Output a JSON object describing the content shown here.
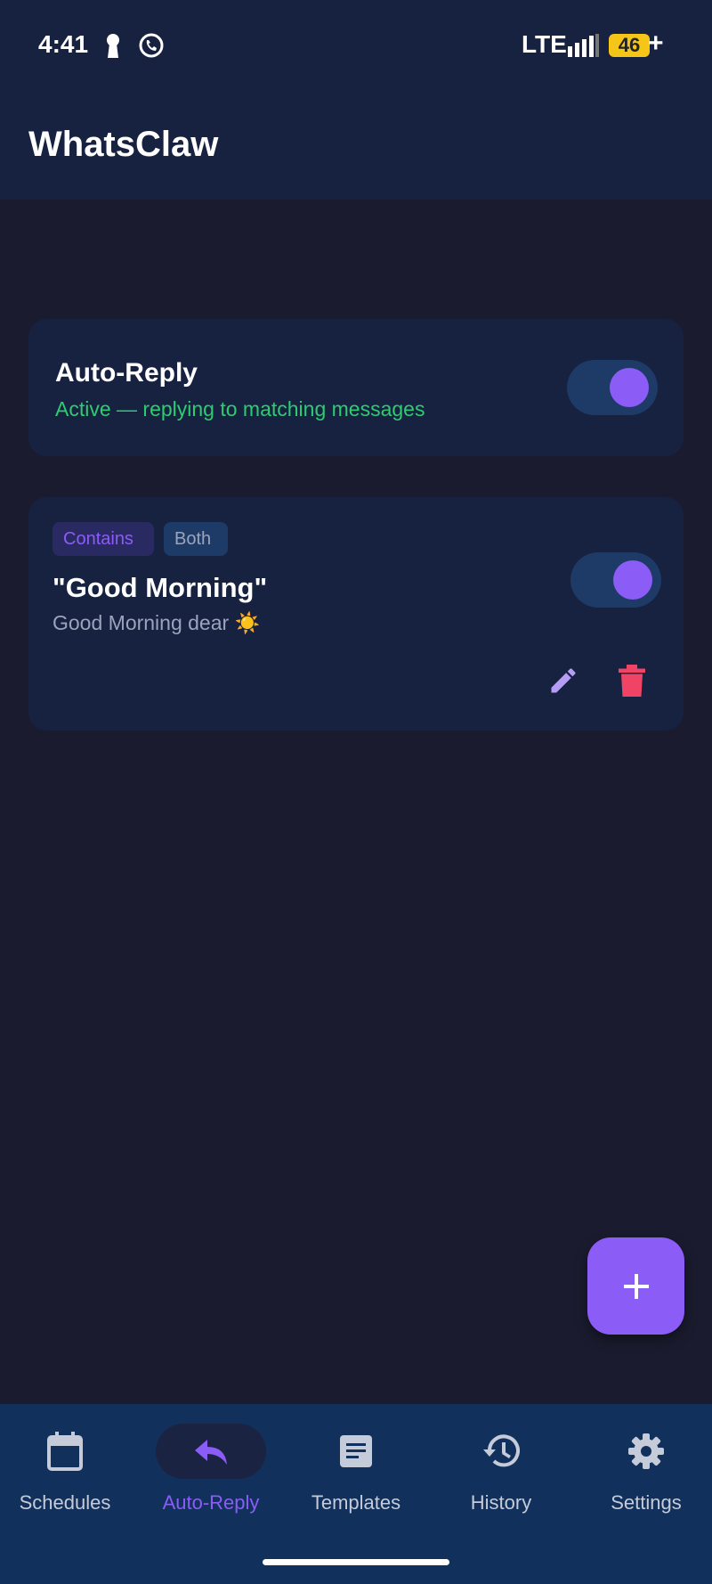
{
  "status_bar": {
    "time": "4:41",
    "network": "LTE",
    "battery": "46",
    "battery_plus": "+"
  },
  "app_bar": {
    "title": "WhatsClaw"
  },
  "auto_reply_card": {
    "title": "Auto-Reply",
    "status": "Active — replying to matching messages",
    "enabled": true,
    "status_color": "#2ecc71"
  },
  "rules": [
    {
      "match_type": "Contains",
      "scope": "Both",
      "keyword": "\"Good Morning\"",
      "reply": "Good Morning dear ☀️",
      "enabled": true
    }
  ],
  "fab": {
    "icon": "plus-icon"
  },
  "bottom_nav": {
    "items": [
      {
        "label": "Schedules",
        "icon": "calendar-icon",
        "active": false
      },
      {
        "label": "Auto-Reply",
        "icon": "reply-icon",
        "active": true
      },
      {
        "label": "Templates",
        "icon": "document-icon",
        "active": false
      },
      {
        "label": "History",
        "icon": "history-icon",
        "active": false
      },
      {
        "label": "Settings",
        "icon": "gear-icon",
        "active": false
      }
    ]
  },
  "colors": {
    "accent": "#8b5cf6",
    "background": "#1a1b2e",
    "surface": "#172140",
    "nav_background": "#12305c",
    "success": "#2ecc71",
    "danger": "#ef4466"
  }
}
